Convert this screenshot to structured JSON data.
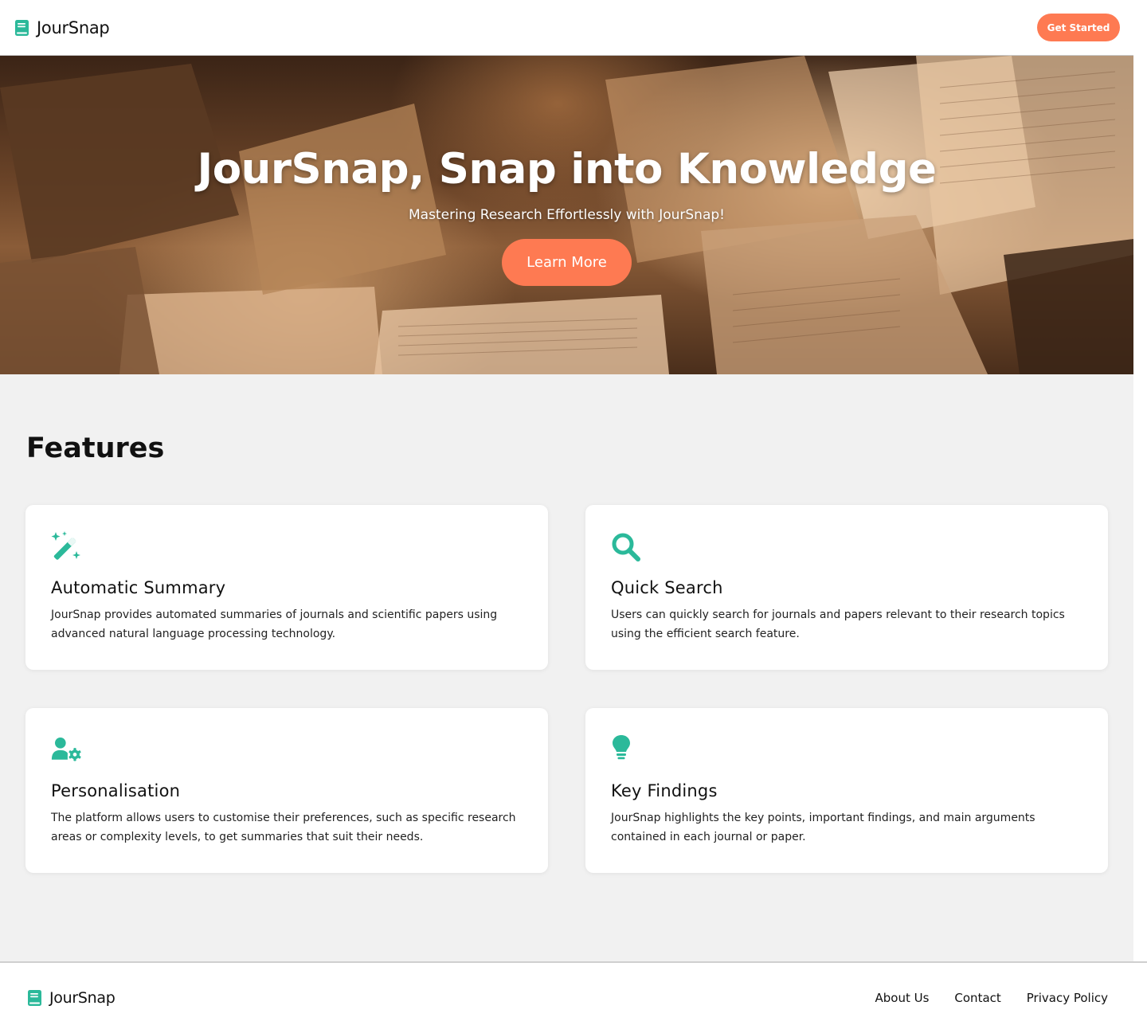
{
  "header": {
    "brand": "JourSnap",
    "cta_label": "Get Started"
  },
  "hero": {
    "title": "JourSnap, Snap into Knowledge",
    "subtitle": "Mastering Research Effortlessly with JourSnap!",
    "cta_label": "Learn More"
  },
  "features": {
    "heading": "Features",
    "items": [
      {
        "icon": "magic-wand-icon",
        "title": "Automatic Summary",
        "description": "JourSnap provides automated summaries of journals and scientific papers using advanced natural language processing technology."
      },
      {
        "icon": "search-icon",
        "title": "Quick Search",
        "description": "Users can quickly search for journals and papers relevant to their research topics using the efficient search feature."
      },
      {
        "icon": "user-gear-icon",
        "title": "Personalisation",
        "description": "The platform allows users to customise their preferences, such as specific research areas or complexity levels, to get summaries that suit their needs."
      },
      {
        "icon": "lightbulb-icon",
        "title": "Key Findings",
        "description": "JourSnap highlights the key points, important findings, and main arguments contained in each journal or paper."
      }
    ]
  },
  "footer": {
    "brand": "JourSnap",
    "links": [
      "About Us",
      "Contact",
      "Privacy Policy"
    ]
  },
  "colors": {
    "accent": "#fe7a52",
    "icon": "#2bb99a",
    "page_bg": "#f1f1f1",
    "card_bg": "#ffffff"
  }
}
